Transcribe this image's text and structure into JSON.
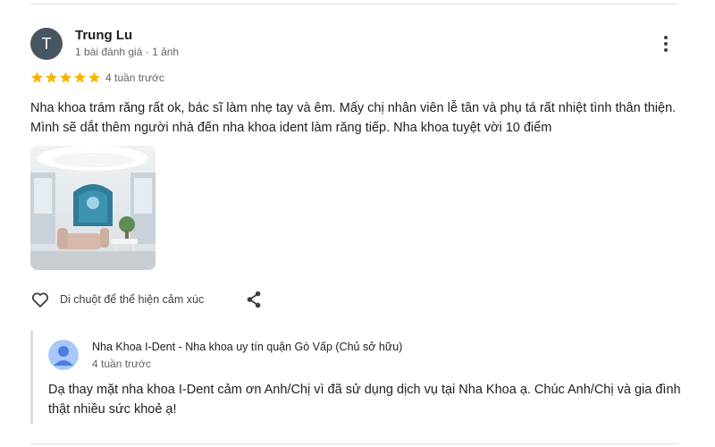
{
  "review": {
    "author_initial": "T",
    "author_name": "Trung Lu",
    "author_meta": "1 bài đánh giá · 1 ảnh",
    "rating": 5,
    "time_ago": "4 tuần trước",
    "text": "Nha khoa trám răng rất ok, bác sĩ làm nhẹ tay và êm. Mấy chị nhân viên lễ tân và phụ tá rất nhiệt tình thân thiện. Mình sẽ dắt thêm người nhà đến nha khoa ident làm răng tiếp. Nha khoa tuyệt vời 10 điểm",
    "more_icon": "more-vert-icon",
    "photo_count": 1
  },
  "actions": {
    "like_icon": "heart-icon",
    "react_label": "Di chuột để thể hiện cảm xúc",
    "share_icon": "share-icon"
  },
  "owner_reply": {
    "name": "Nha Khoa I-Dent - Nha khoa uy tín quận Gò Vấp (Chủ sở hữu)",
    "time_ago": "4 tuần trước",
    "text": "Dạ thay mặt nha khoa I-Dent cảm ơn Anh/Chị vì đã sử dụng dịch vụ tại Nha Khoa ạ. Chúc Anh/Chị và gia đình thật nhiều sức khoẻ ạ!"
  },
  "colors": {
    "star": "#f6b400",
    "avatar_bg": "#4a5562",
    "owner_avatar_bg": "#a8c7fa",
    "reply_bar": "#dadce0"
  }
}
